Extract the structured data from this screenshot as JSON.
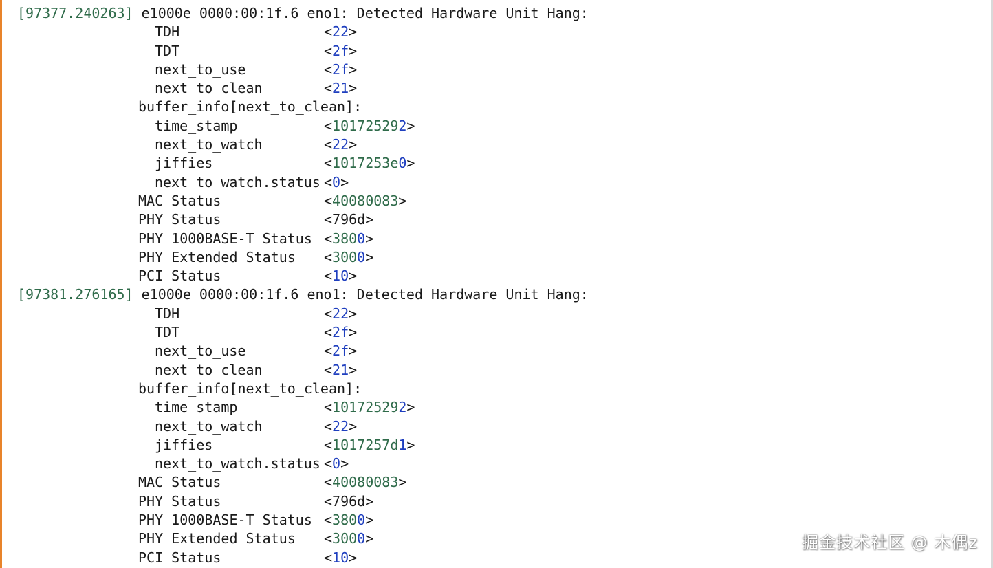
{
  "top_partial": "[               ]                  ",
  "blocks": [
    {
      "timestamp": "[97377.240263]",
      "message": " e1000e 0000:00:1f.6 eno1: Detected Hardware Unit Hang:",
      "entries": [
        {
          "label": "TDH",
          "open": "<",
          "val_a": "22",
          "val_b": "",
          "close": ">",
          "level": 2
        },
        {
          "label": "TDT",
          "open": "<",
          "val_a": "2f",
          "val_b": "",
          "close": ">",
          "level": 2
        },
        {
          "label": "next_to_use",
          "open": "<",
          "val_a": "2f",
          "val_b": "",
          "close": ">",
          "level": 2
        },
        {
          "label": "next_to_clean",
          "open": "<",
          "val_a": "21",
          "val_b": "",
          "close": ">",
          "level": 2
        },
        {
          "label": "buffer_info[next_to_clean]:",
          "open": "",
          "val_a": "",
          "val_b": "",
          "close": "",
          "level": 1
        },
        {
          "label": "time_stamp",
          "open": "<",
          "val_a": "10172529",
          "val_b": "2",
          "close": ">",
          "level": 2
        },
        {
          "label": "next_to_watch",
          "open": "<",
          "val_a": "22",
          "val_b": "",
          "close": ">",
          "level": 2
        },
        {
          "label": "jiffies",
          "open": "<",
          "val_a": "1017253e",
          "val_b": "0",
          "close": ">",
          "level": 2
        },
        {
          "label": "next_to_watch.status",
          "open": "<",
          "val_a": "0",
          "val_b": "",
          "close": ">",
          "level": 2
        },
        {
          "label": "MAC Status",
          "open": "<",
          "val_a": "40080083",
          "val_b": "",
          "close": ">",
          "level": 1
        },
        {
          "label": "PHY Status",
          "open": "<",
          "val_a": "796d",
          "val_b": "",
          "close": ">",
          "level": 1
        },
        {
          "label": "PHY 1000BASE-T Status",
          "open": "<",
          "val_a": "380",
          "val_b": "0",
          "close": ">",
          "level": 1
        },
        {
          "label": "PHY Extended Status",
          "open": "<",
          "val_a": "300",
          "val_b": "0",
          "close": ">",
          "level": 1
        },
        {
          "label": "PCI Status",
          "open": "<",
          "val_a": "10",
          "val_b": "",
          "close": ">",
          "level": 1
        }
      ]
    },
    {
      "timestamp": "[97381.276165]",
      "message": " e1000e 0000:00:1f.6 eno1: Detected Hardware Unit Hang:",
      "entries": [
        {
          "label": "TDH",
          "open": "<",
          "val_a": "22",
          "val_b": "",
          "close": ">",
          "level": 2
        },
        {
          "label": "TDT",
          "open": "<",
          "val_a": "2f",
          "val_b": "",
          "close": ">",
          "level": 2
        },
        {
          "label": "next_to_use",
          "open": "<",
          "val_a": "2f",
          "val_b": "",
          "close": ">",
          "level": 2
        },
        {
          "label": "next_to_clean",
          "open": "<",
          "val_a": "21",
          "val_b": "",
          "close": ">",
          "level": 2
        },
        {
          "label": "buffer_info[next_to_clean]:",
          "open": "",
          "val_a": "",
          "val_b": "",
          "close": "",
          "level": 1
        },
        {
          "label": "time_stamp",
          "open": "<",
          "val_a": "10172529",
          "val_b": "2",
          "close": ">",
          "level": 2
        },
        {
          "label": "next_to_watch",
          "open": "<",
          "val_a": "22",
          "val_b": "",
          "close": ">",
          "level": 2
        },
        {
          "label": "jiffies",
          "open": "<",
          "val_a": "1017257d",
          "val_b": "1",
          "close": ">",
          "level": 2
        },
        {
          "label": "next_to_watch.status",
          "open": "<",
          "val_a": "0",
          "val_b": "",
          "close": ">",
          "level": 2
        },
        {
          "label": "MAC Status",
          "open": "<",
          "val_a": "40080083",
          "val_b": "",
          "close": ">",
          "level": 1
        },
        {
          "label": "PHY Status",
          "open": "<",
          "val_a": "796d",
          "val_b": "",
          "close": ">",
          "level": 1
        },
        {
          "label": "PHY 1000BASE-T Status",
          "open": "<",
          "val_a": "380",
          "val_b": "0",
          "close": ">",
          "level": 1
        },
        {
          "label": "PHY Extended Status",
          "open": "<",
          "val_a": "300",
          "val_b": "0",
          "close": ">",
          "level": 1
        },
        {
          "label": "PCI Status",
          "open": "<",
          "val_a": "10",
          "val_b": "",
          "close": ">",
          "level": 1
        }
      ]
    }
  ],
  "watermark": "掘金技术社区 @ 木偶z",
  "colors": {
    "accent_left_border": "#e8832a",
    "timestamp": "#2f6b4a",
    "hex_digits": "#2f6b4a",
    "hex_trailing": "#1f3fbf",
    "text": "#1a1a1a"
  }
}
